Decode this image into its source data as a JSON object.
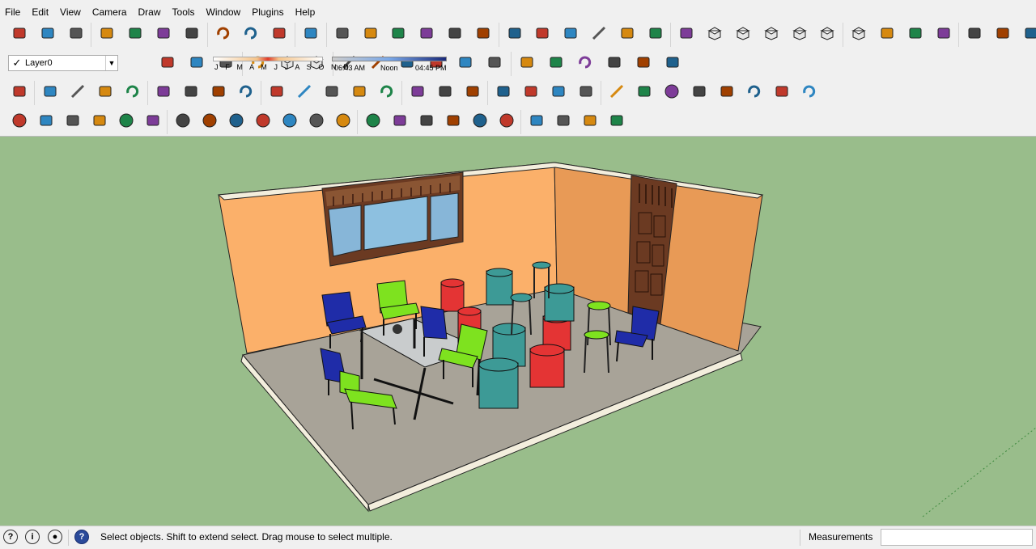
{
  "menu": [
    "File",
    "Edit",
    "View",
    "Camera",
    "Draw",
    "Tools",
    "Window",
    "Plugins",
    "Help"
  ],
  "layer": {
    "current": "Layer0"
  },
  "shadows": {
    "months": "J F M A M J J A S O N D",
    "time_start": "06:43 AM",
    "time_mid": "Noon",
    "time_end": "04:45 PM"
  },
  "status": {
    "hint": "Select objects. Shift to extend select. Drag mouse to select multiple.",
    "measurements_label": "Measurements",
    "measurements_value": ""
  },
  "colors": {
    "background_ground": "#99bd8b",
    "wall": "#fbb06a",
    "floor": "#b0aca2",
    "chair_blue": "#1f2ca8",
    "chair_green": "#7ee21f",
    "stool_red": "#e43434",
    "stool_teal": "#3d9a96"
  },
  "toolbar_icons": {
    "row1": [
      "new-icon",
      "open-icon",
      "save-icon",
      "cut-icon",
      "copy-icon",
      "paste-icon",
      "erase-icon",
      "undo-icon",
      "redo-icon",
      "print-icon",
      "model-info-icon",
      "make-component-icon",
      "group-icon",
      "component-a-icon",
      "component-b-icon",
      "component-c-icon",
      "component-d-icon",
      "xray-icon",
      "back-edges-icon",
      "wireframe-icon",
      "hidden-line-icon",
      "shaded-icon",
      "shaded-textures-icon",
      "monochrome-icon",
      "iso-view-icon",
      "top-view-icon",
      "front-view-icon",
      "right-view-icon",
      "back-view-icon",
      "left-view-icon",
      "walk-icon",
      "look-around-icon",
      "position-camera-icon",
      "section-plane-icon",
      "section-display-icon",
      "section-cuts-icon"
    ],
    "row2": [
      "layer-manager-icon",
      "display-shadows-icon",
      "fog-icon",
      "camera-orbit-icon",
      "iso-box-icon",
      "iso-box2-icon",
      "tape-measure-icon",
      "dimension-icon",
      "protractor-icon",
      "text-icon",
      "axes-icon",
      "3d-text-icon",
      "move-icon",
      "push-pull-icon",
      "rotate-icon",
      "follow-me-icon",
      "scale-icon",
      "offset-icon"
    ],
    "row3": [
      "select-icon",
      "eraser-icon",
      "pencil-icon",
      "rectangle-icon",
      "rotated-rect-icon",
      "push-pull-icon",
      "follow-me-icon",
      "move-icon",
      "rotate-icon",
      "scale-icon",
      "tape-icon",
      "text-label-icon",
      "paint-bucket-icon",
      "orbit-icon",
      "pan-icon",
      "zoom-icon",
      "zoom-extents-icon",
      "warehouse-icon",
      "extension-icon",
      "share-model-icon",
      "send-to-layout-icon",
      "line-icon",
      "freehand-icon",
      "circle-icon",
      "bezier-icon",
      "polygon-icon",
      "arc-icon",
      "pie-icon",
      "arc3-icon"
    ],
    "row4": [
      "sphere-icon",
      "cone-icon",
      "flag-icon",
      "dome-icon",
      "ball-icon",
      "hat-icon",
      "m-plugin-icon",
      "tag-plugin-icon",
      "r-plugin-icon",
      "rt-plugin-icon",
      "br-plugin-icon",
      "help-plugin-icon",
      "label-plugin-icon",
      "sphere2-icon",
      "plane-icon",
      "terrain-icon",
      "terrain2-icon",
      "target-icon",
      "pause-icon",
      "warehouse2-icon",
      "extension2-icon",
      "share2-icon",
      "layout2-icon"
    ]
  }
}
